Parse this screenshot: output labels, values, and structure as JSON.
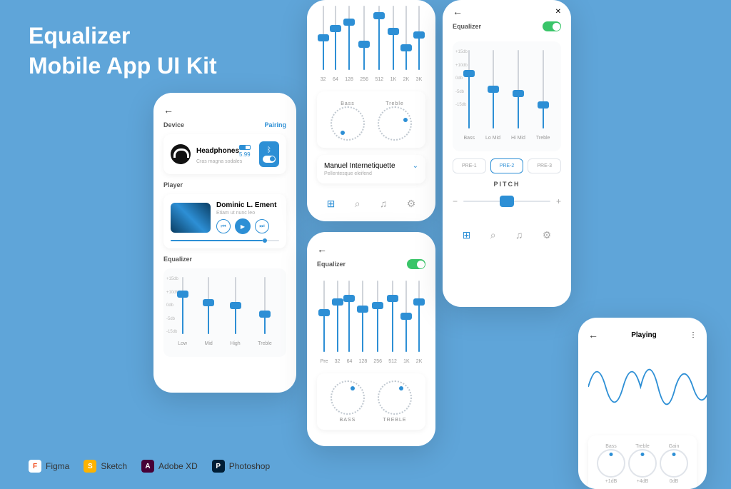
{
  "title": "Equalizer\nMobile App UI Kit",
  "tools": [
    {
      "name": "Figma",
      "color": "#fff"
    },
    {
      "name": "Sketch",
      "color": "#fdb300"
    },
    {
      "name": "Adobe XD",
      "color": "#470137"
    },
    {
      "name": "Photoshop",
      "color": "#001e36"
    }
  ],
  "p1": {
    "device": "Device",
    "pairing": "Pairing",
    "hp_name": "Headphones",
    "hp_sub": "Cras magna sodales",
    "battery": "5.99",
    "player": "Player",
    "track": "Dominic L. Ement",
    "track_sub": "Etiam ut nunc leo",
    "eq": "Equalizer",
    "bands": [
      "Low",
      "Mid",
      "High",
      "Treble"
    ],
    "band_values": [
      70,
      55,
      50,
      35
    ],
    "y": [
      "+15db",
      "+10db",
      "0db",
      "-5db",
      "-15db"
    ]
  },
  "p2": {
    "bands": [
      "32",
      "64",
      "128",
      "256",
      "512",
      "1K",
      "2K",
      "3K"
    ],
    "band_values": [
      50,
      65,
      75,
      40,
      85,
      60,
      35,
      55
    ],
    "bass": "Bass",
    "treble": "Treble",
    "profile": "Manuel Internetiquette",
    "profile_sub": "Pellentesque eleifend"
  },
  "p3": {
    "eq": "Equalizer",
    "bands": [
      "Pre",
      "32",
      "64",
      "128",
      "256",
      "512",
      "1K",
      "2K"
    ],
    "band_values": [
      55,
      70,
      75,
      60,
      65,
      75,
      50,
      70
    ],
    "bass": "BASS",
    "treble": "TREBLE"
  },
  "p4": {
    "eq": "Equalizer",
    "bands": [
      "Bass",
      "Lo Mid",
      "Hi Mid",
      "Treble"
    ],
    "band_values": [
      70,
      50,
      45,
      30
    ],
    "y": [
      "+15db",
      "+10db",
      "0db",
      "-5db",
      "-15db"
    ],
    "presets": [
      "PRE-1",
      "PRE-2",
      "PRE-3"
    ],
    "pitch": "PITCH"
  },
  "p5": {
    "title": "Playing",
    "dials": [
      {
        "label": "Bass",
        "value": "+1dB"
      },
      {
        "label": "Treble",
        "value": "+4dB"
      },
      {
        "label": "Gain",
        "value": "0dB"
      }
    ]
  }
}
